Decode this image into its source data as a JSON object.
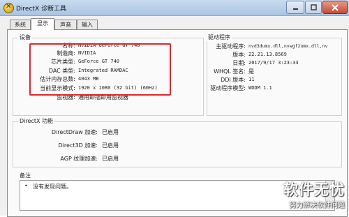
{
  "window": {
    "title": "DirectX 诊断工具"
  },
  "tabs": [
    {
      "label": "系统"
    },
    {
      "label": "显示"
    },
    {
      "label": "声音"
    },
    {
      "label": "输入"
    }
  ],
  "device": {
    "group_title": "设备",
    "rows": [
      {
        "label": "名称:",
        "value": "NVIDIA GeForce GT 740"
      },
      {
        "label": "制造商:",
        "value": "NVIDIA"
      },
      {
        "label": "芯片类型:",
        "value": "GeForce GT 740"
      },
      {
        "label": "DAC 类型:",
        "value": "Integrated RAMDAC"
      },
      {
        "label": "估计内存总数:",
        "value": "4043 MB"
      },
      {
        "label": "当前显示模式:",
        "value": "1920 x 1080 (32 bit) (60Hz)"
      },
      {
        "label": "监视器:",
        "value": "通用即插即用监视器"
      }
    ]
  },
  "driver": {
    "group_title": "驱动程序",
    "rows": [
      {
        "label": "主驱动程序:",
        "value": "nvd3dumx.dll,nvwgf2umx.dll,nv"
      },
      {
        "label": "版本:",
        "value": "22.21.13.8569"
      },
      {
        "label": "日期:",
        "value": "2017/9/17 3:23:33"
      },
      {
        "label": "WHQL 签名:",
        "value": "是"
      },
      {
        "label": "DDI 版本:",
        "value": "11"
      },
      {
        "label": "驱动程序模型:",
        "value": "WDDM 1.1"
      }
    ]
  },
  "directx_features": {
    "group_title": "DirectX 功能",
    "rows": [
      {
        "label": "DirectDraw 加速:",
        "value": "已启用"
      },
      {
        "label": "Direct3D 加速:",
        "value": "已启用"
      },
      {
        "label": "AGP 纹理加速:",
        "value": "已启用"
      }
    ]
  },
  "notes": {
    "group_title": "备注",
    "items": [
      "没有发现问题。"
    ]
  },
  "watermark": {
    "logo": "软件无忧",
    "tagline": "努力解决软件问题"
  },
  "colors": {
    "highlight": "#e0262b",
    "titlebar": "#b9d1ea",
    "close_button": "#c44a35"
  }
}
